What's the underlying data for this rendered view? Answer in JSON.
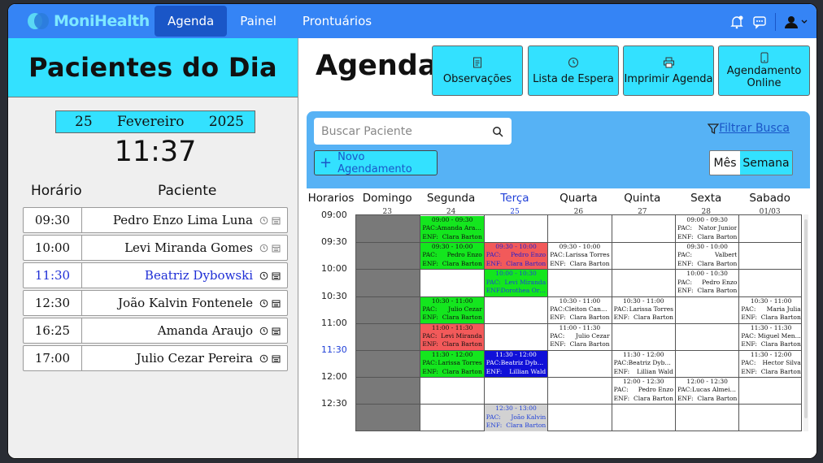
{
  "navbar": {
    "brand": "MoniHealth",
    "links": [
      "Agenda",
      "Painel",
      "Prontuários"
    ],
    "active_link": "Agenda"
  },
  "left": {
    "title": "Pacientes do Dia",
    "date": {
      "day": "25",
      "month": "Fevereiro",
      "year": "2025"
    },
    "clock": "11:37",
    "col_time": "Horário",
    "col_patient": "Paciente",
    "patients": [
      {
        "time": "09:30",
        "name": "Pedro Enzo Lima Luna"
      },
      {
        "time": "10:00",
        "name": "Levi Miranda Gomes"
      },
      {
        "time": "11:30",
        "name": "Beatriz Dybowski",
        "highlight": true
      },
      {
        "time": "12:30",
        "name": "João Kalvin Fontenele"
      },
      {
        "time": "16:25",
        "name": "Amanda Araujo"
      },
      {
        "time": "17:00",
        "name": "Julio Cezar Pereira"
      }
    ]
  },
  "right": {
    "title": "Agenda",
    "buttons": {
      "observacoes": "Observações",
      "lista_espera": "Lista de Espera",
      "imprimir": "Imprimir Agenda",
      "online": "Agendamento Online"
    },
    "search_placeholder": "Buscar Paciente",
    "filter_label": "Filtrar Busca",
    "new_button": "Novo Agendamento",
    "view_mes": "Mês",
    "view_semana": "Semana"
  },
  "calendar": {
    "horarios_label": "Horarios",
    "days": [
      {
        "name": "Domingo",
        "num": "23"
      },
      {
        "name": "Segunda",
        "num": "24"
      },
      {
        "name": "Terça",
        "num": "25",
        "today": true
      },
      {
        "name": "Quarta",
        "num": "26"
      },
      {
        "name": "Quinta",
        "num": "27"
      },
      {
        "name": "Sexta",
        "num": "28"
      },
      {
        "name": "Sabado",
        "num": "01/03"
      }
    ],
    "times": [
      "09:00",
      "09:30",
      "10:00",
      "10:30",
      "11:00",
      "11:30",
      "12:00",
      "12:30"
    ],
    "current_time": "11:30",
    "events": [
      {
        "day": 1,
        "slot": 0,
        "color": "green",
        "time": "09:00 - 09:30",
        "pac": "Amanda Araujo",
        "enf": "Clara Barton"
      },
      {
        "day": 1,
        "slot": 1,
        "color": "green",
        "time": "09:30 - 10:00",
        "pac": "Pedro Enzo",
        "enf": "Clara Barton"
      },
      {
        "day": 1,
        "slot": 3,
        "color": "green",
        "time": "10:30 - 11:00",
        "pac": "Julio Cezar",
        "enf": "Clara Barton"
      },
      {
        "day": 1,
        "slot": 4,
        "color": "red",
        "time": "11:00 - 11:30",
        "pac": "Levi Miranda",
        "enf": "Clara Barton"
      },
      {
        "day": 1,
        "slot": 5,
        "color": "green",
        "time": "11:30 - 12:00",
        "pac": "Larissa Torres",
        "enf": "Clara Barton"
      },
      {
        "day": 2,
        "slot": 1,
        "color": "red sel",
        "time": "09:30 - 10:00",
        "pac": "Pedro Enzo",
        "enf": "Clara Barton"
      },
      {
        "day": 2,
        "slot": 2,
        "color": "green blue-text",
        "time": "10:00 - 10:30",
        "pac": "Levi Miranda",
        "enf": "Dorothea Orem"
      },
      {
        "day": 2,
        "slot": 5,
        "color": "blue",
        "time": "11:30 - 12:00",
        "pac": "Beatriz Dybo...",
        "enf": "Lillian Wald"
      },
      {
        "day": 2,
        "slot": 7,
        "color": "gray",
        "time": "12:30 - 13:00",
        "pac": "João Kalvin",
        "enf": "Clara Barton"
      },
      {
        "day": 3,
        "slot": 1,
        "color": "white",
        "time": "09:30 - 10:00",
        "pac": "Larissa Torres",
        "enf": "Clara Barton"
      },
      {
        "day": 3,
        "slot": 3,
        "color": "white",
        "time": "10:30 - 11:00",
        "pac": "Cleiton Cana...",
        "enf": "Clara Barton"
      },
      {
        "day": 3,
        "slot": 4,
        "color": "white",
        "time": "11:00 - 11:30",
        "pac": "Julio Cezar",
        "enf": "Clara Barton"
      },
      {
        "day": 4,
        "slot": 3,
        "color": "white",
        "time": "10:30 - 11:00",
        "pac": "Larissa Torres",
        "enf": "Clara Barton"
      },
      {
        "day": 4,
        "slot": 5,
        "color": "white",
        "time": "11:30 - 12:00",
        "pac": "Beatriz Dybo...",
        "enf": "Lillian Wald"
      },
      {
        "day": 4,
        "slot": 6,
        "color": "white",
        "time": "12:00 - 12:30",
        "pac": "Pedro Enzo",
        "enf": "Clara Barton"
      },
      {
        "day": 5,
        "slot": 0,
        "color": "white",
        "time": "09:00 - 09:30",
        "pac": "Nator Junior",
        "enf": "Clara Barton"
      },
      {
        "day": 5,
        "slot": 1,
        "color": "white",
        "time": "09:30 - 10:00",
        "pac": "Valbert",
        "enf": "Clara Barton"
      },
      {
        "day": 5,
        "slot": 2,
        "color": "white",
        "time": "10:00 - 10:30",
        "pac": "Pedro Enzo",
        "enf": "Clara Barton"
      },
      {
        "day": 5,
        "slot": 6,
        "color": "white",
        "time": "12:00 - 12:30",
        "pac": "Lucas Almeida",
        "enf": "Clara Barton"
      },
      {
        "day": 6,
        "slot": 3,
        "color": "white",
        "time": "10:30 - 11:00",
        "pac": "Maria Julia",
        "enf": "Clara Barton"
      },
      {
        "day": 6,
        "slot": 4,
        "color": "white",
        "time": "11:30 - 11:30",
        "pac": "Miguel Men...",
        "enf": "Clara Barton"
      },
      {
        "day": 6,
        "slot": 5,
        "color": "white",
        "time": "11:30 - 12:00",
        "pac": "Hector Silva",
        "enf": "Clara Barton"
      }
    ],
    "event_pac_key": "PAC:",
    "event_enf_key": "ENF:"
  }
}
